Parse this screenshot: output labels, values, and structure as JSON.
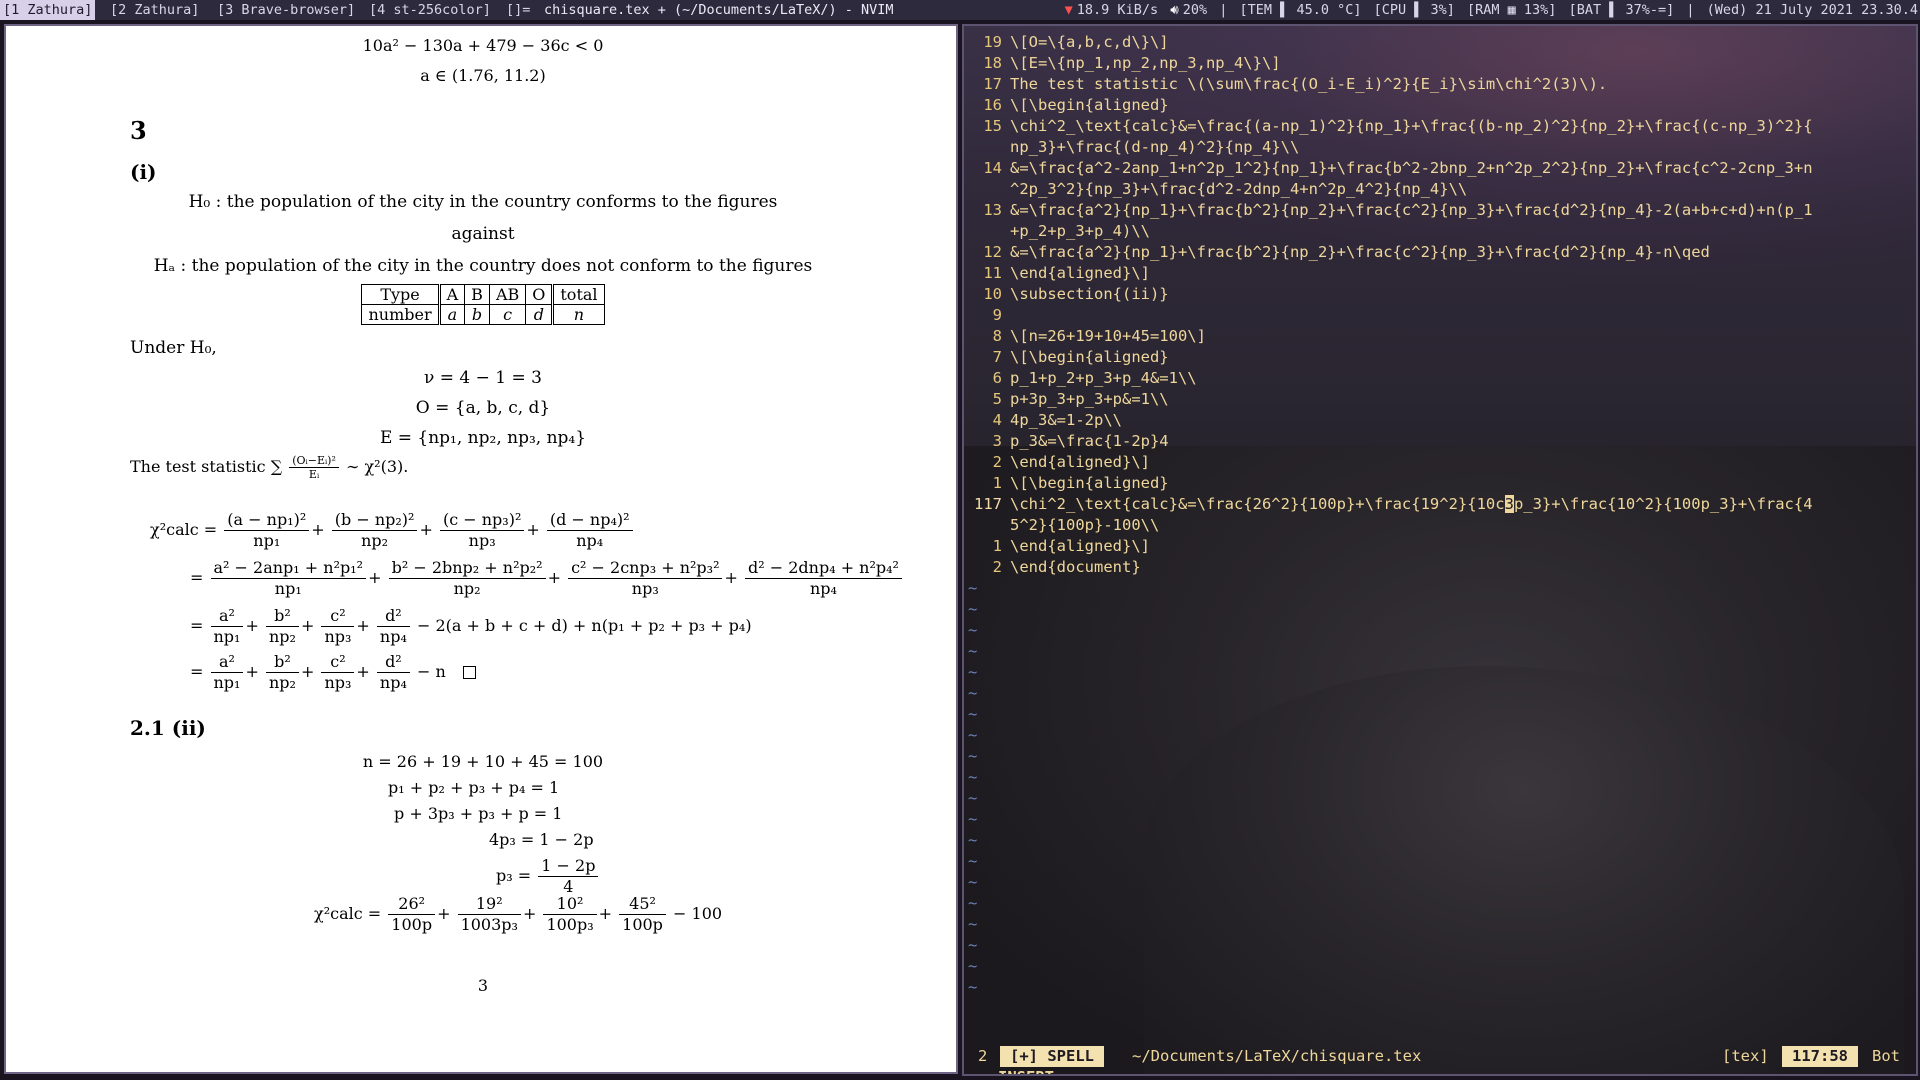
{
  "topbar": {
    "tabs": [
      "[1 Zathura]",
      "[2 Zathura]",
      "[3 Brave-browser]",
      "[4 st-256color]",
      "[]="
    ],
    "window_title": "chisquare.tex + (~/Documents/LaTeX/) - NVIM",
    "net": "18.9 KiB/s",
    "volume": "20%",
    "temp": "[TEM ▌ 45.0 °C]",
    "cpu": "[CPU ▌ 3%]",
    "ram": "[RAM ▦ 13%]",
    "bat": "[BAT ▌ 37%-=]",
    "datetime": "(Wed) 21 July 2021 23.30.4"
  },
  "pdf": {
    "frag_top1": "10a² − 130a + 479 − 36c < 0",
    "frag_top2": "a ∈ (1.76, 11.2)",
    "section_num": "3",
    "sub_i": "(i)",
    "h0_text": "H₀ : the population of the city in the country conforms to the figures",
    "against": "against",
    "ha_text": "Hₐ : the population of the city in the country does not conform to the figures",
    "table": {
      "row1": [
        "Type",
        "A",
        "B",
        "AB",
        "O",
        "total"
      ],
      "row2": [
        "number",
        "a",
        "b",
        "c",
        "d",
        "n"
      ]
    },
    "under_h0": "Under H₀,",
    "nu": "ν = 4 − 1 = 3",
    "O_set": "O = {a, b, c, d}",
    "E_set": "E = {np₁, np₂, np₃, np₄}",
    "test_stat_prefix": "The test statistic ∑",
    "test_stat_num": "(Oᵢ−Eᵢ)²",
    "test_stat_den": "Eᵢ",
    "test_stat_suffix": "∼ χ²(3).",
    "chi_lhs": "χ²calc =",
    "eq1": {
      "terms": [
        [
          "(a − np₁)²",
          "np₁"
        ],
        [
          "(b − np₂)²",
          "np₂"
        ],
        [
          "(c − np₃)²",
          "np₃"
        ],
        [
          "(d − np₄)²",
          "np₄"
        ]
      ]
    },
    "eq2": {
      "terms": [
        [
          "a² − 2anp₁ + n²p₁²",
          "np₁"
        ],
        [
          "b² − 2bnp₂ + n²p₂²",
          "np₂"
        ],
        [
          "c² − 2cnp₃ + n²p₃²",
          "np₃"
        ],
        [
          "d² − 2dnp₄ + n²p₄²",
          "np₄"
        ]
      ]
    },
    "eq3": {
      "terms": [
        [
          "a²",
          "np₁"
        ],
        [
          "b²",
          "np₂"
        ],
        [
          "c²",
          "np₃"
        ],
        [
          "d²",
          "np₄"
        ]
      ],
      "tail": "− 2(a + b + c + d) + n(p₁ + p₂ + p₃ + p₄)"
    },
    "eq4": {
      "terms": [
        [
          "a²",
          "np₁"
        ],
        [
          "b²",
          "np₂"
        ],
        [
          "c²",
          "np₃"
        ],
        [
          "d²",
          "np₄"
        ]
      ],
      "tail": "− n"
    },
    "subsection": "2.1    (ii)",
    "n_eq": "n = 26 + 19 + 10 + 45 = 100",
    "al1": "p₁ + p₂ + p₃ + p₄ = 1",
    "al2": "p + 3p₃ + p₃ + p = 1",
    "al3": "4p₃ = 1 − 2p",
    "al4_lhs": "p₃ =",
    "al4_num": "1 − 2p",
    "al4_den": "4",
    "chi2_lhs": "χ²calc =",
    "chi2_terms": [
      [
        "26²",
        "100p"
      ],
      [
        "19²",
        "1003p₃"
      ],
      [
        "10²",
        "100p₃"
      ],
      [
        "45²",
        "100p"
      ]
    ],
    "chi2_tail": "− 100",
    "page_number": "3"
  },
  "editor": {
    "lines": [
      {
        "num": "19",
        "text": "\\[O=\\{a,b,c,d\\}\\]"
      },
      {
        "num": "18",
        "text": "\\[E=\\{np_1,np_2,np_3,np_4\\}\\]"
      },
      {
        "num": "17",
        "text": "The test statistic \\(\\sum\\frac{(O_i-E_i)^2}{E_i}\\sim\\chi^2(3)\\)."
      },
      {
        "num": "16",
        "text": "\\[\\begin{aligned}"
      },
      {
        "num": "15",
        "text": "    \\chi^2_\\text{calc}&=\\frac{(a-np_1)^2}{np_1}+\\frac{(b-np_2)^2}{np_2}+\\frac{(c-np_3)^2}{"
      },
      {
        "num": "",
        "text": "np_3}+\\frac{(d-np_4)^2}{np_4}\\\\"
      },
      {
        "num": "14",
        "text": "    &=\\frac{a^2-2anp_1+n^2p_1^2}{np_1}+\\frac{b^2-2bnp_2+n^2p_2^2}{np_2}+\\frac{c^2-2cnp_3+n"
      },
      {
        "num": "",
        "text": "^2p_3^2}{np_3}+\\frac{d^2-2dnp_4+n^2p_4^2}{np_4}\\\\"
      },
      {
        "num": "13",
        "text": "    &=\\frac{a^2}{np_1}+\\frac{b^2}{np_2}+\\frac{c^2}{np_3}+\\frac{d^2}{np_4}-2(a+b+c+d)+n(p_1"
      },
      {
        "num": "",
        "text": "+p_2+p_3+p_4)\\\\"
      },
      {
        "num": "12",
        "text": "    &=\\frac{a^2}{np_1}+\\frac{b^2}{np_2}+\\frac{c^2}{np_3}+\\frac{d^2}{np_4}-n\\qed"
      },
      {
        "num": "11",
        "text": "\\end{aligned}\\]"
      },
      {
        "num": "10",
        "text": "\\subsection{(ii)}"
      },
      {
        "num": "9",
        "text": ""
      },
      {
        "num": "8",
        "text": "\\[n=26+19+10+45=100\\]"
      },
      {
        "num": "7",
        "text": "\\[\\begin{aligned}"
      },
      {
        "num": "6",
        "text": "    p_1+p_2+p_3+p_4&=1\\\\"
      },
      {
        "num": "5",
        "text": "    p+3p_3+p_3+p&=1\\\\"
      },
      {
        "num": "4",
        "text": "    4p_3&=1-2p\\\\"
      },
      {
        "num": "3",
        "text": "    p_3&=\\frac{1-2p}4"
      },
      {
        "num": "2",
        "text": "\\end{aligned}\\]"
      },
      {
        "num": "1",
        "text": "\\[\\begin{aligned}"
      }
    ],
    "current_line": {
      "num": "117",
      "before_cursor": "    \\chi^2_\\text{calc}&=\\frac{26^2}{100p}+\\frac{19^2}{10c",
      "cursor_char": "3",
      "after_cursor": "p_3}+\\frac{10^2}{100p_3}+\\frac{4"
    },
    "after_lines": [
      {
        "num": "",
        "text": "5^2}{100p}-100\\\\"
      },
      {
        "num": "1",
        "text": "\\end{aligned}\\]"
      },
      {
        "num": "2",
        "text": "\\end{document}"
      }
    ],
    "tilde": "~",
    "status": {
      "num": "2",
      "mode": "[+]  SPELL",
      "path": "~/Documents/LaTeX/chisquare.tex",
      "filetype": "[tex]",
      "position": "117:58",
      "scroll": "Bot"
    },
    "cmdline": "-- INSERT --"
  }
}
